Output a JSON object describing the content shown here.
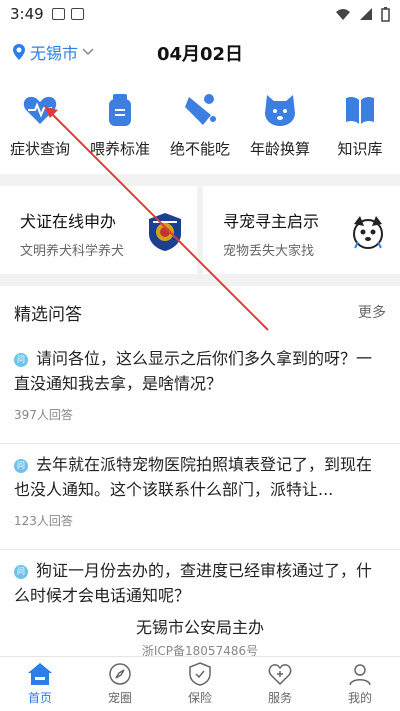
{
  "status_bar": {
    "time": "3:49",
    "battery_icon": "battery-icon",
    "wifi_icon": "wifi-icon",
    "signal_icon": "signal-icon"
  },
  "header": {
    "location": "无锡市",
    "date": "04月02日"
  },
  "icon_row": [
    {
      "label": "症状查询",
      "icon": "heart-pulse-icon"
    },
    {
      "label": "喂养标准",
      "icon": "food-bag-icon"
    },
    {
      "label": "绝不能吃",
      "icon": "no-eat-icon"
    },
    {
      "label": "年龄换算",
      "icon": "dog-face-icon"
    },
    {
      "label": "知识库",
      "icon": "book-icon"
    }
  ],
  "cards": [
    {
      "title": "犬证在线申办",
      "subtitle": "文明养犬科学养犬"
    },
    {
      "title": "寻宠寻主启示",
      "subtitle": "宠物丢失大家找"
    }
  ],
  "qa": {
    "title": "精选问答",
    "more": "更多",
    "questions": [
      {
        "text": "请问各位，这么显示之后你们多久拿到的呀？一直没通知我去拿，是啥情况？",
        "count": "397人回答"
      },
      {
        "text": "去年就在派特宠物医院拍照填表登记了，到现在也没人通知。这个该联系什么部门，派特让...",
        "count": "123人回答"
      },
      {
        "text": "狗证一月份去办的，查进度已经审核通过了，什么时候才会电话通知呢？",
        "count": ""
      }
    ]
  },
  "footer": {
    "line1": "无锡市公安局主办",
    "line2": "浙ICP备18057486号"
  },
  "tabs": [
    {
      "label": "首页",
      "active": true
    },
    {
      "label": "宠圈",
      "active": false
    },
    {
      "label": "保险",
      "active": false
    },
    {
      "label": "服务",
      "active": false
    },
    {
      "label": "我的",
      "active": false
    }
  ],
  "colors": {
    "accent": "#2b7fe6",
    "arrow": "#e03a3a"
  }
}
